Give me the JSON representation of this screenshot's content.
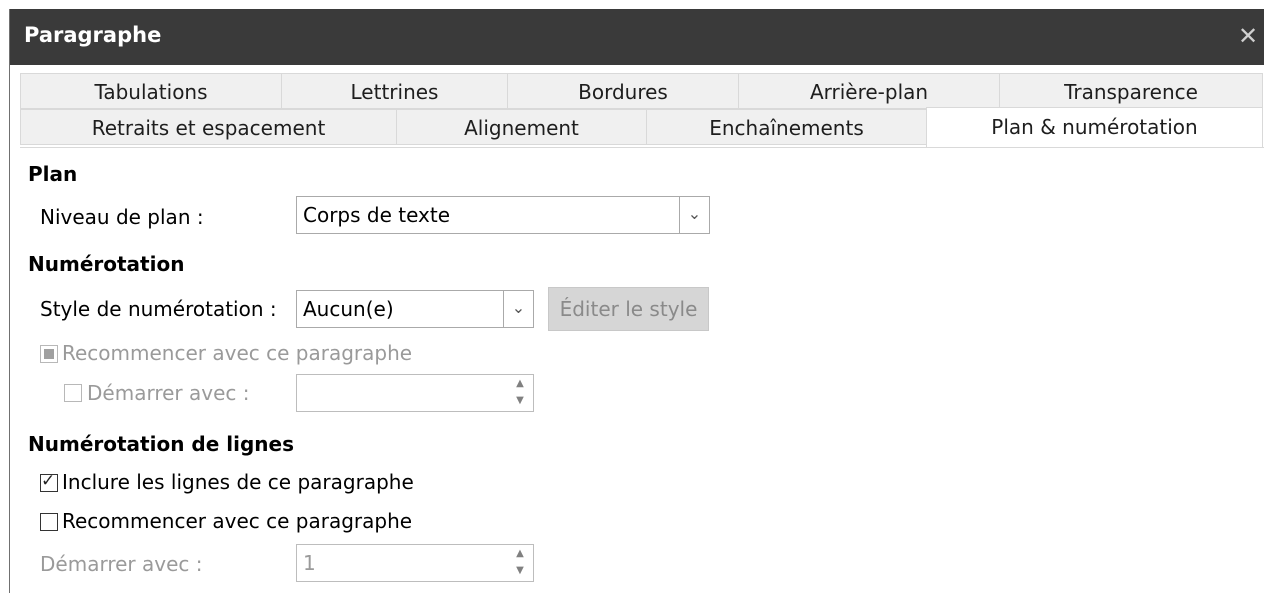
{
  "window": {
    "title": "Paragraphe"
  },
  "tabs_row1": [
    "Tabulations",
    "Lettrines",
    "Bordures",
    "Arrière-plan",
    "Transparence"
  ],
  "tabs_row2": [
    "Retraits et espacement",
    "Alignement",
    "Enchaînements",
    "Plan & numérotation"
  ],
  "active_tab": "Plan & numérotation",
  "plan": {
    "heading": "Plan",
    "level_label": "Niveau de plan :",
    "level_value": "Corps de texte"
  },
  "numbering": {
    "heading": "Numérotation",
    "style_label": "Style de numérotation :",
    "style_value": "Aucun(e)",
    "edit_button": "Éditer le style",
    "restart_label": "Recommencer avec ce paragraphe",
    "start_label": "Démarrer avec :",
    "start_value": ""
  },
  "line_numbering": {
    "heading": "Numérotation de lignes",
    "include_label": "Inclure les lignes de ce paragraphe",
    "include_checked": true,
    "restart_label": "Recommencer avec ce paragraphe",
    "restart_checked": false,
    "start_label": "Démarrer avec :",
    "start_value": "1"
  },
  "icons": {
    "close": "close-icon",
    "dropdown": "chevron-down-icon",
    "spin_up": "spin-up-icon",
    "spin_down": "spin-down-icon"
  },
  "colors": {
    "titlebar": "#3a3a3a",
    "title_text": "#ffffff",
    "disabled_text": "#9a9a9a"
  }
}
